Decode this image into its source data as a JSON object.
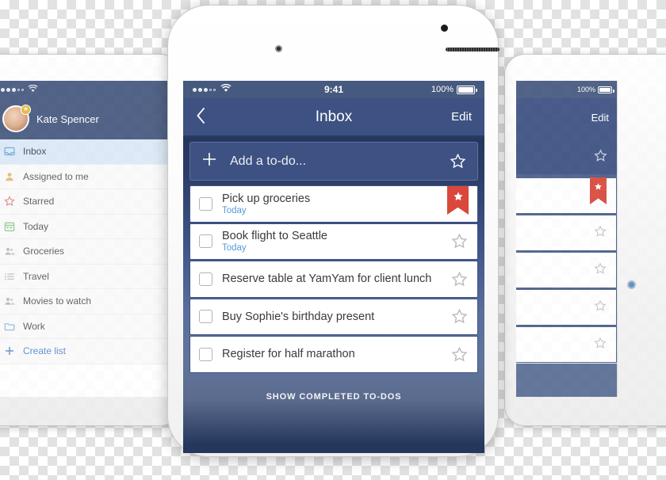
{
  "left_device": {
    "status": {
      "signal_dots_filled": 3,
      "signal_dots_empty": 2,
      "wifi_icon": "wifi-icon"
    },
    "user": {
      "name": "Kate Spencer",
      "avatar_icon": "avatar",
      "badge_icon": "star-badge-icon"
    },
    "items": [
      {
        "label": "Inbox",
        "icon": "inbox-icon",
        "selected": true
      },
      {
        "label": "Assigned to me",
        "icon": "person-icon",
        "selected": false
      },
      {
        "label": "Starred",
        "icon": "star-icon",
        "selected": false
      },
      {
        "label": "Today",
        "icon": "calendar-icon",
        "selected": false
      },
      {
        "label": "Groceries",
        "icon": "people-icon",
        "selected": false
      },
      {
        "label": "Travel",
        "icon": "list-icon",
        "selected": false
      },
      {
        "label": "Movies to watch",
        "icon": "people-icon",
        "selected": false
      },
      {
        "label": "Work",
        "icon": "folder-icon",
        "selected": false
      },
      {
        "label": "Create list",
        "icon": "plus-icon",
        "selected": false
      }
    ]
  },
  "right_device": {
    "status": {
      "battery_percent": "100%"
    },
    "nav": {
      "edit_label": "Edit"
    },
    "rows_count": 5,
    "starred_row_index": 0
  },
  "phone": {
    "status": {
      "signal_dots_filled": 3,
      "signal_dots_empty": 2,
      "wifi_icon": "wifi-icon",
      "clock": "9:41",
      "battery_percent": "100%",
      "battery_icon": "battery-full-icon"
    },
    "nav": {
      "back_icon": "chevron-left-icon",
      "title": "Inbox",
      "edit_label": "Edit"
    },
    "add_row": {
      "plus_icon": "plus-icon",
      "placeholder": "Add a to-do...",
      "star_icon": "star-outline-icon"
    },
    "todos": [
      {
        "label": "Pick up groceries",
        "due": "Today",
        "starred": true,
        "checked": false
      },
      {
        "label": "Book flight to Seattle",
        "due": "Today",
        "starred": false,
        "checked": false
      },
      {
        "label": "Reserve table at YamYam for client lunch",
        "due": "",
        "starred": false,
        "checked": false
      },
      {
        "label": "Buy Sophie's birthday present",
        "due": "",
        "starred": false,
        "checked": false
      },
      {
        "label": "Register for half marathon",
        "due": "",
        "starred": false,
        "checked": false
      }
    ],
    "footer": {
      "show_completed_label": "SHOW COMPLETED TO-DOS"
    }
  },
  "colors": {
    "nav_blue": "#3d5182",
    "status_blue": "#46597f",
    "dark_navy": "#26375e",
    "ribbon_red": "#d9483b",
    "due_blue": "#5a9ad9",
    "selected_row": "#dce9f7"
  }
}
